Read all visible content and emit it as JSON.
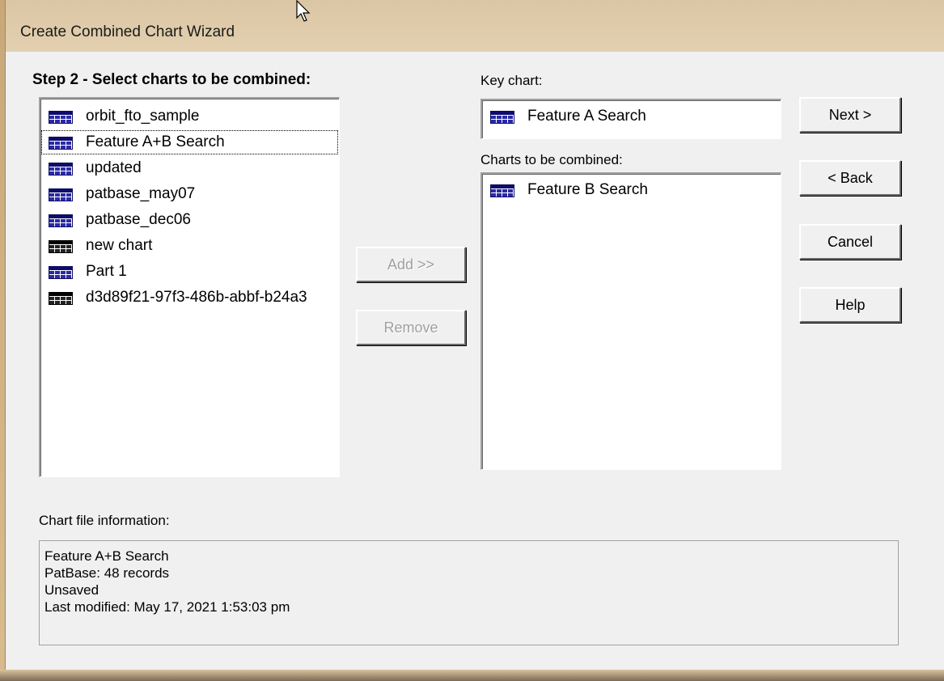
{
  "window": {
    "title": "Create Combined Chart Wizard"
  },
  "step_title": "Step 2 - Select charts to be combined:",
  "available_charts": [
    {
      "label": "orbit_fto_sample",
      "icon": "grid-icon"
    },
    {
      "label": "Feature A+B Search",
      "icon": "grid-icon"
    },
    {
      "label": "updated",
      "icon": "grid-icon"
    },
    {
      "label": "patbase_may07",
      "icon": "grid-icon"
    },
    {
      "label": "patbase_dec06",
      "icon": "grid-icon"
    },
    {
      "label": "new chart",
      "icon": "grid-icon"
    },
    {
      "label": "Part 1",
      "icon": "grid-icon"
    },
    {
      "label": "d3d89f21-97f3-486b-abbf-b24a3",
      "icon": "grid-icon"
    }
  ],
  "key_chart": {
    "label": "Key chart:",
    "value": "Feature A Search",
    "icon": "grid-icon"
  },
  "combined": {
    "label": "Charts to be combined:",
    "items": [
      {
        "label": "Feature B Search",
        "icon": "grid-icon"
      }
    ]
  },
  "buttons": {
    "add": "Add >>",
    "remove": "Remove",
    "next": "Next >",
    "back": "< Back",
    "cancel": "Cancel",
    "help": "Help"
  },
  "info": {
    "label": "Chart file information:",
    "lines": [
      "Feature A+B Search",
      "PatBase: 48 records",
      "Unsaved",
      "Last modified: May 17, 2021 1:53:03 pm"
    ]
  }
}
